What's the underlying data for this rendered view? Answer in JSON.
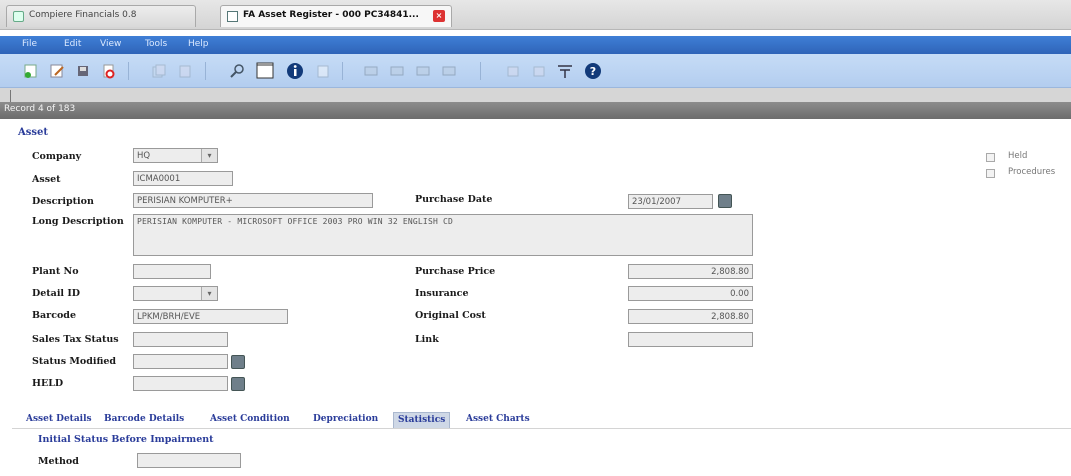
{
  "browser": {
    "tabs": [
      {
        "label": "Compiere Financials 0.8"
      },
      {
        "label": "FA Asset Register - 000 PC34841..."
      }
    ]
  },
  "menu": [
    "File",
    "Edit",
    "View",
    "Tools",
    "Help"
  ],
  "toolbar": {
    "icons": [
      "new-record-icon",
      "edit-icon",
      "save-icon",
      "delete-icon",
      "copy-icon",
      "paste-icon",
      "search-icon",
      "blank-page-icon",
      "info-icon",
      "report-icon",
      "first-record-icon",
      "previous-record-icon",
      "next-record-icon",
      "last-record-icon",
      "attachment-icon",
      "refresh-icon",
      "filter-icon",
      "help-icon"
    ]
  },
  "record": {
    "label": "Record 4 of 183"
  },
  "asset_section": {
    "title": "Asset",
    "company": {
      "label": "Company",
      "value": "HQ"
    },
    "asset": {
      "label": "Asset",
      "value": "ICMA0001"
    },
    "description": {
      "label": "Description",
      "value": "PERISIAN KOMPUTER+"
    },
    "long_description": {
      "label": "Long Description",
      "value": "PERISIAN KOMPUTER - MICROSOFT OFFICE 2003 PRO WIN 32 ENGLISH CD"
    },
    "plant_no": {
      "label": "Plant No",
      "value": ""
    },
    "detail_id": {
      "label": "Detail ID",
      "value": ""
    },
    "barcode": {
      "label": "Barcode",
      "value": "LPKM/BRH/EVE"
    },
    "sales_tax_status": {
      "label": "Sales Tax Status",
      "value": ""
    },
    "status_modified": {
      "label": "Status Modified",
      "value": ""
    },
    "held": {
      "label": "HELD",
      "value": ""
    },
    "purchase_date": {
      "label": "Purchase Date",
      "value": "23/01/2007"
    },
    "purchase_price": {
      "label": "Purchase Price",
      "value": "2,808.80"
    },
    "insurance": {
      "label": "Insurance",
      "value": "0.00"
    },
    "original_cost": {
      "label": "Original Cost",
      "value": "2,808.80"
    },
    "link": {
      "label": "Link",
      "value": ""
    },
    "checkboxes": [
      {
        "label": "Held"
      },
      {
        "label": "Procedures"
      }
    ]
  },
  "detail_tabs": [
    {
      "label": "Asset Details"
    },
    {
      "label": "Barcode Details"
    },
    {
      "label": "Asset Condition"
    },
    {
      "label": "Depreciation"
    },
    {
      "label": "Statistics"
    },
    {
      "label": "Asset Charts"
    }
  ],
  "impairment": {
    "title": "Initial Status Before Impairment",
    "method": {
      "label": "Method",
      "value": ""
    }
  },
  "colors": {
    "menubar": "#2f64b8",
    "toolbar": "#b3cdef",
    "section_title": "#2a3c9a"
  }
}
